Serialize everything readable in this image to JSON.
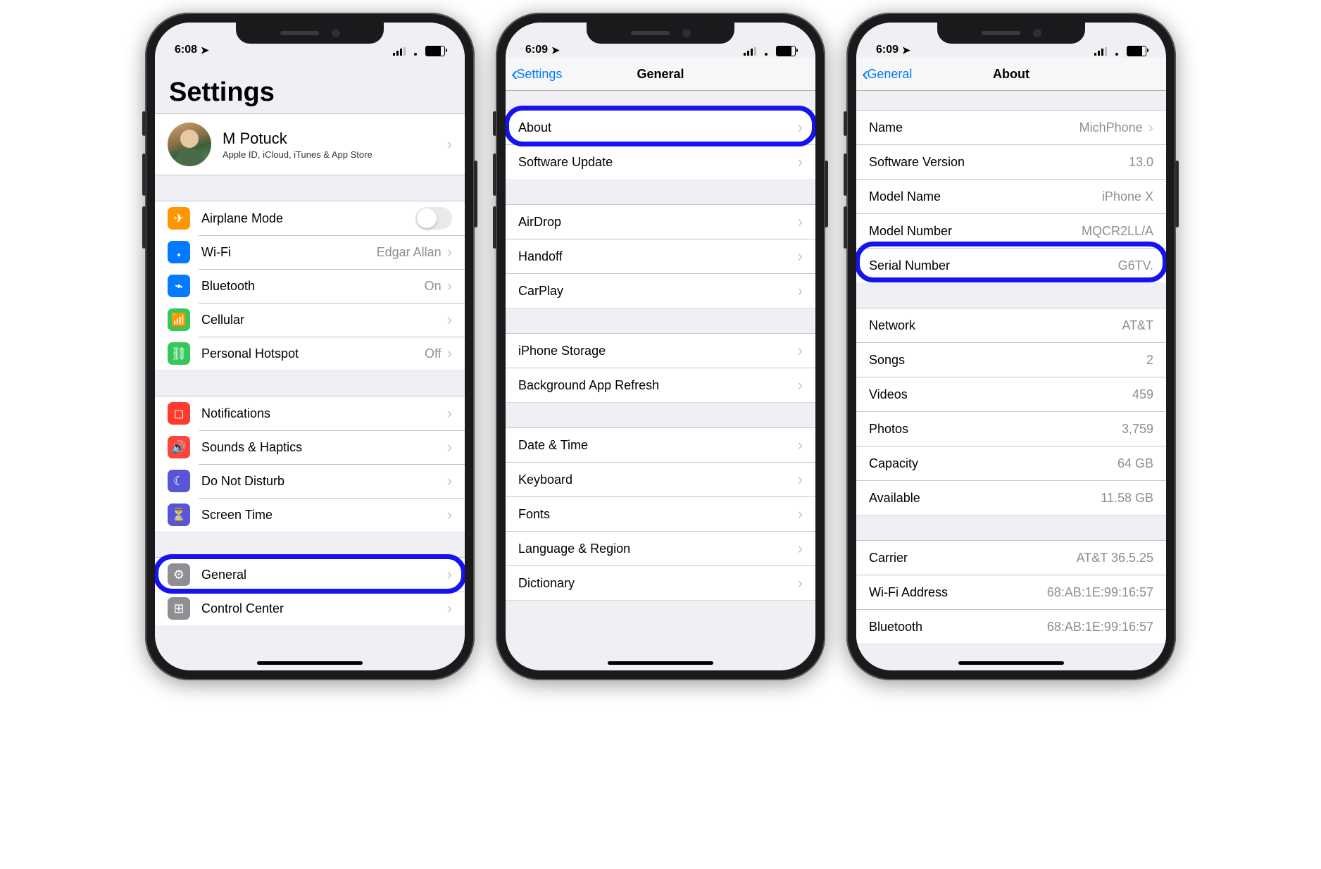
{
  "phone1": {
    "status": {
      "time": "6:08"
    },
    "title": "Settings",
    "profile": {
      "name": "M Potuck",
      "sub": "Apple ID, iCloud, iTunes & App Store"
    },
    "rows": {
      "airplane": "Airplane Mode",
      "wifi": "Wi-Fi",
      "wifi_detail": "Edgar Allan",
      "bt": "Bluetooth",
      "bt_detail": "On",
      "cell": "Cellular",
      "hotspot": "Personal Hotspot",
      "hotspot_detail": "Off",
      "notif": "Notifications",
      "sounds": "Sounds & Haptics",
      "dnd": "Do Not Disturb",
      "screen": "Screen Time",
      "general": "General",
      "cc": "Control Center"
    }
  },
  "phone2": {
    "status": {
      "time": "6:09"
    },
    "nav_back": "Settings",
    "nav_title": "General",
    "rows": {
      "about": "About",
      "update": "Software Update",
      "airdrop": "AirDrop",
      "handoff": "Handoff",
      "carplay": "CarPlay",
      "storage": "iPhone Storage",
      "bgrefresh": "Background App Refresh",
      "datetime": "Date & Time",
      "keyboard": "Keyboard",
      "fonts": "Fonts",
      "lang": "Language & Region",
      "dict": "Dictionary"
    }
  },
  "phone3": {
    "status": {
      "time": "6:09"
    },
    "nav_back": "General",
    "nav_title": "About",
    "rows": {
      "name": "Name",
      "name_v": "MichPhone",
      "swver": "Software Version",
      "swver_v": "13.0",
      "model": "Model Name",
      "model_v": "iPhone X",
      "modelnum": "Model Number",
      "modelnum_v": "MQCR2LL/A",
      "serial": "Serial Number",
      "serial_v": "G6TV.",
      "network": "Network",
      "network_v": "AT&T",
      "songs": "Songs",
      "songs_v": "2",
      "videos": "Videos",
      "videos_v": "459",
      "photos": "Photos",
      "photos_v": "3,759",
      "capacity": "Capacity",
      "capacity_v": "64 GB",
      "avail": "Available",
      "avail_v": "11.58 GB",
      "carrier": "Carrier",
      "carrier_v": "AT&T 36.5.25",
      "wifiaddr": "Wi-Fi Address",
      "wifiaddr_v": "68:AB:1E:99:16:57",
      "btaddr": "Bluetooth",
      "btaddr_v": "68:AB:1E:99:16:57"
    }
  }
}
